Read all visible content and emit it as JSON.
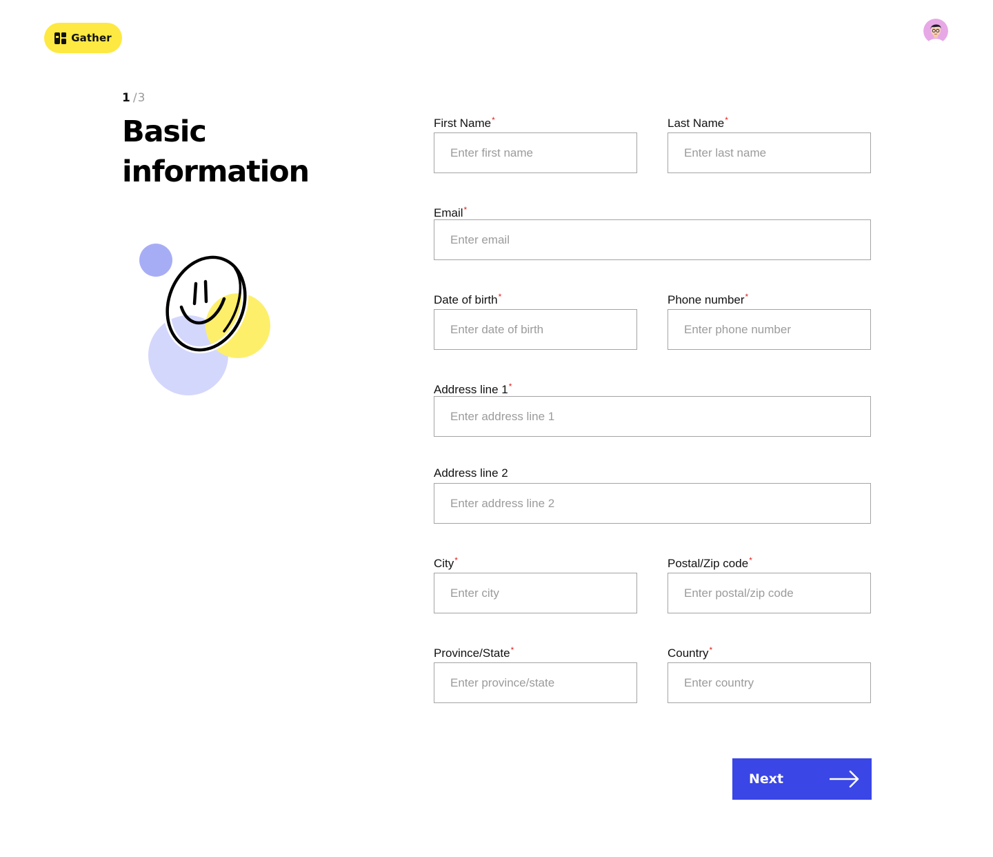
{
  "header": {
    "brand": "Gather",
    "brand_color": "#fde941",
    "logo_icon": "gather-logo-icon",
    "avatar_icon": "user-avatar-icon"
  },
  "intro": {
    "step_current": "1",
    "step_separator": "/",
    "step_total": "3",
    "title": "Basic information",
    "illustration": "smiley-circles-illustration"
  },
  "form": {
    "required_mark": "*",
    "fields": {
      "first_name": {
        "label": "First Name",
        "placeholder": "Enter first name",
        "required": true
      },
      "last_name": {
        "label": "Last Name",
        "placeholder": "Enter last name",
        "required": true
      },
      "email": {
        "label": "Email",
        "placeholder": "Enter email",
        "required": true
      },
      "dob": {
        "label": "Date of birth",
        "placeholder": "Enter date of birth",
        "required": true
      },
      "phone": {
        "label": "Phone number",
        "placeholder": "Enter phone number",
        "required": true
      },
      "address1": {
        "label": "Address line 1",
        "placeholder": "Enter address line 1",
        "required": true
      },
      "address2": {
        "label": "Address line 2",
        "placeholder": "Enter address line 2",
        "required": false
      },
      "city": {
        "label": "City",
        "placeholder": "Enter city",
        "required": true
      },
      "postal": {
        "label": "Postal/Zip code",
        "placeholder": "Enter postal/zip code",
        "required": true
      },
      "province": {
        "label": "Province/State",
        "placeholder": "Enter province/state",
        "required": true
      },
      "country": {
        "label": "Country",
        "placeholder": "Enter country",
        "required": true
      }
    }
  },
  "actions": {
    "next_label": "Next",
    "next_icon": "arrow-right-icon",
    "accent_color": "#3a46e6"
  }
}
